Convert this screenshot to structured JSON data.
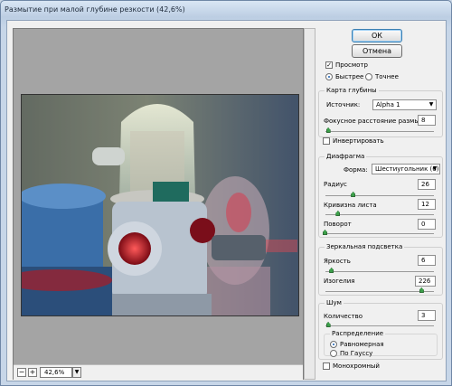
{
  "window": {
    "title": "Размытие при малой глубине резкости (42,6%)"
  },
  "buttons": {
    "ok": "ОК",
    "cancel": "Отмена"
  },
  "preview": {
    "label": "Просмотр",
    "checked": true,
    "fast": "Быстрее",
    "accurate": "Точнее",
    "mode": "fast"
  },
  "depth_map": {
    "title": "Карта глубины",
    "source_label": "Источник:",
    "source_value": "Alpha 1",
    "focal_label": "Фокусное расстояние размытия",
    "focal_value": "8",
    "focal_level": 0.03,
    "invert_label": "Инвертировать",
    "invert_checked": false
  },
  "iris": {
    "title": "Диафрагма",
    "shape_label": "Форма:",
    "shape_value": "Шестиугольник (6)",
    "radius_label": "Радиус",
    "radius_value": "26",
    "radius_level": 0.26,
    "curvature_label": "Кривизна листа",
    "curvature_value": "12",
    "curvature_level": 0.12,
    "rotation_label": "Поворот",
    "rotation_value": "0",
    "rotation_level": 0.0
  },
  "highlight": {
    "title": "Зеркальная подсветка",
    "brightness_label": "Яркость",
    "brightness_value": "6",
    "brightness_level": 0.06,
    "threshold_label": "Изогелия",
    "threshold_value": "226",
    "threshold_level": 0.89
  },
  "noise": {
    "title": "Шум",
    "amount_label": "Количество",
    "amount_value": "3",
    "amount_level": 0.03,
    "distribution_title": "Распределение",
    "uniform": "Равномерная",
    "gaussian": "По Гауссу",
    "distribution": "uniform",
    "mono_label": "Монохромный",
    "mono_checked": false
  },
  "zoom": {
    "value": "42,6%",
    "minus": "−",
    "plus": "+"
  }
}
